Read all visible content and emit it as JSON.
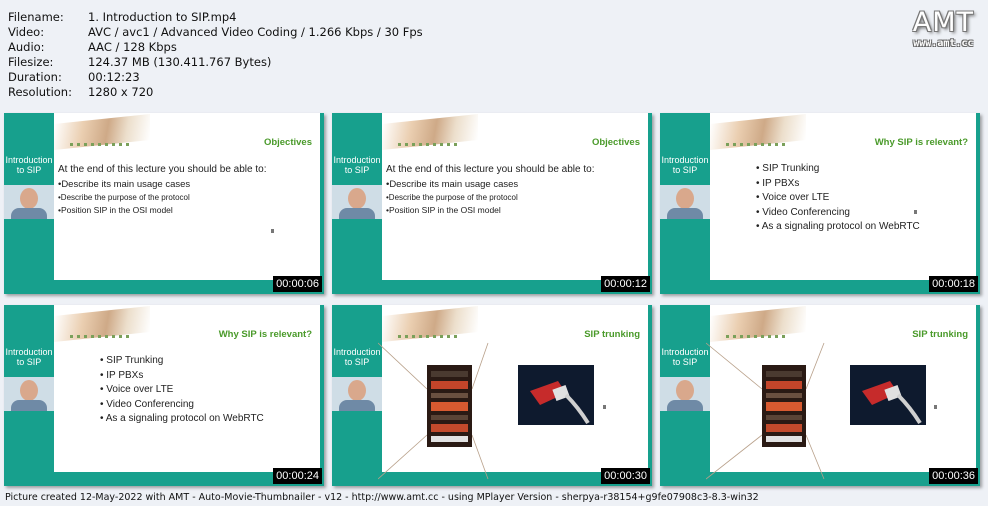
{
  "info": {
    "filename_label": "Filename:",
    "filename": "1. Introduction to SIP.mp4",
    "video_label": "Video:",
    "video": "AVC / avc1 / Advanced Video Coding / 1.266 Kbps / 30 Fps",
    "audio_label": "Audio:",
    "audio": "AAC / 128 Kbps",
    "filesize_label": "Filesize:",
    "filesize": "124.37 MB (130.411.767 Bytes)",
    "duration_label": "Duration:",
    "duration": "00:12:23",
    "resolution_label": "Resolution:",
    "resolution": "1280 x 720"
  },
  "logo": {
    "title": "AMT",
    "url": "www.amt.cc"
  },
  "thumbnails": [
    {
      "timestamp": "00:00:06",
      "sidebar_title": "Introduction to SIP",
      "slide_title": "Objectives",
      "lead": "At the end of this lecture you should be able to:",
      "bullets": [
        "•Describe its main usage cases",
        "•Describe the purpose of the protocol",
        "•Position SIP in the OSI model"
      ]
    },
    {
      "timestamp": "00:00:12",
      "sidebar_title": "Introduction to SIP",
      "slide_title": "Objectives",
      "lead": "At the end of this lecture you should be able to:",
      "bullets": [
        "•Describe its main usage cases",
        "•Describe the purpose of the protocol",
        "•Position SIP in the OSI model"
      ]
    },
    {
      "timestamp": "00:00:18",
      "sidebar_title": "Introduction to SIP",
      "slide_title": "Why SIP is relevant?",
      "bullets": [
        "•  SIP Trunking",
        "•  IP PBXs",
        "•  Voice over LTE",
        "•  Video Conferencing",
        "•  As a signaling protocol on WebRTC"
      ]
    },
    {
      "timestamp": "00:00:24",
      "sidebar_title": "Introduction to SIP",
      "slide_title": "Why SIP is relevant?",
      "bullets": [
        "•  SIP Trunking",
        "•  IP PBXs",
        "•  Voice over LTE",
        "•  Video Conferencing",
        "•  As a signaling protocol on WebRTC"
      ]
    },
    {
      "timestamp": "00:00:30",
      "sidebar_title": "Introduction to SIP",
      "slide_title": "SIP trunking"
    },
    {
      "timestamp": "00:00:36",
      "sidebar_title": "Introduction to SIP",
      "slide_title": "SIP trunking"
    }
  ],
  "footer": "Picture created 12-May-2022 with AMT - Auto-Movie-Thumbnailer - v12 - http://www.amt.cc - using MPlayer Version - sherpya-r38154+g9fe07908c3-8.3-win32",
  "colors": {
    "accent": "#17a08d",
    "slide_title": "#4a9a2a",
    "background": "#eef1f6"
  }
}
